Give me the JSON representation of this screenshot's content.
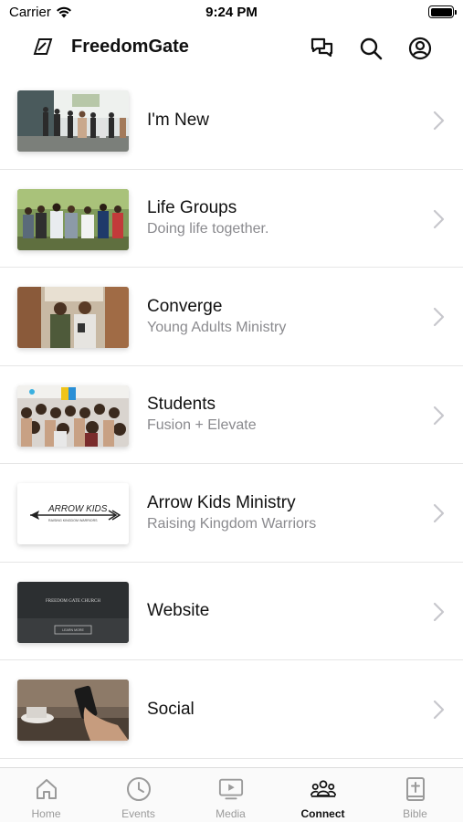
{
  "status_bar": {
    "carrier": "Carrier",
    "time": "9:24 PM"
  },
  "header": {
    "title": "FreedomGate"
  },
  "list": [
    {
      "title": "I'm New",
      "subtitle": "",
      "image": "outdoor-gathering-photo"
    },
    {
      "title": "Life Groups",
      "subtitle": "Doing life together.",
      "image": "group-prayer-photo"
    },
    {
      "title": "Converge",
      "subtitle": "Young Adults Ministry",
      "image": "two-men-photo"
    },
    {
      "title": "Students",
      "subtitle": "Fusion + Elevate",
      "image": "students-crowd-photo"
    },
    {
      "title": "Arrow Kids Ministry",
      "subtitle": "Raising Kingdom Warriors",
      "image": "arrow-kids-logo"
    },
    {
      "title": "Website",
      "subtitle": "",
      "image": "website-screenshot"
    },
    {
      "title": "Social",
      "subtitle": "",
      "image": "phone-in-hand-photo"
    }
  ],
  "logo_texts": {
    "arrow_kids": "ARROW KIDS",
    "arrow_kids_tag": "RAISING KINGDOM WARRIORS",
    "website_heading": "FREEDOM GATE CHURCH",
    "website_button": "LEARN MORE"
  },
  "tabs": [
    {
      "label": "Home",
      "icon": "home-icon",
      "active": false
    },
    {
      "label": "Events",
      "icon": "clock-icon",
      "active": false
    },
    {
      "label": "Media",
      "icon": "tv-play-icon",
      "active": false
    },
    {
      "label": "Connect",
      "icon": "people-icon",
      "active": true
    },
    {
      "label": "Bible",
      "icon": "bible-icon",
      "active": false
    }
  ],
  "colors": {
    "text": "#111111",
    "subtitle": "#8a8a8e",
    "chevron": "#c7c7cc",
    "tab_inactive": "#9a9a9a",
    "tab_active": "#111111"
  }
}
